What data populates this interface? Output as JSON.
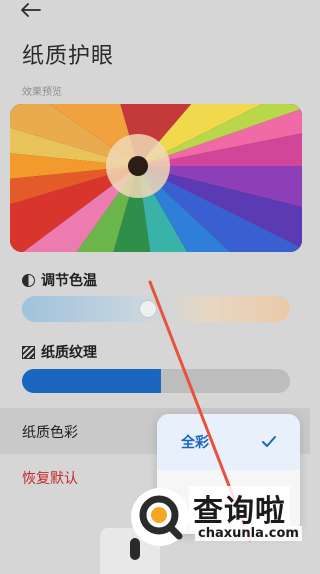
{
  "header": {
    "back_icon": "arrow-left-icon",
    "title": "纸质护眼"
  },
  "preview": {
    "label": "效果预览",
    "image_desc_icon": "colored-pencils-image"
  },
  "color_temperature": {
    "label": "调节色温",
    "icon": "half-circle-icon",
    "level": 0.47
  },
  "paper_texture": {
    "label": "纸质纹理",
    "icon": "stripe-icon",
    "level": 0.52
  },
  "paper_color": {
    "label": "纸质色彩"
  },
  "reset": {
    "label": "恢复默认"
  },
  "dropdown": {
    "options": [
      {
        "label": "全彩",
        "selected": true,
        "icon": "check-icon"
      }
    ]
  },
  "watermark": {
    "title": "查询啦",
    "url": "chaxunla.com"
  },
  "colors": {
    "accent": "#1a66bf",
    "reset_red": "#c4282c",
    "arrow": "#e8523c"
  }
}
